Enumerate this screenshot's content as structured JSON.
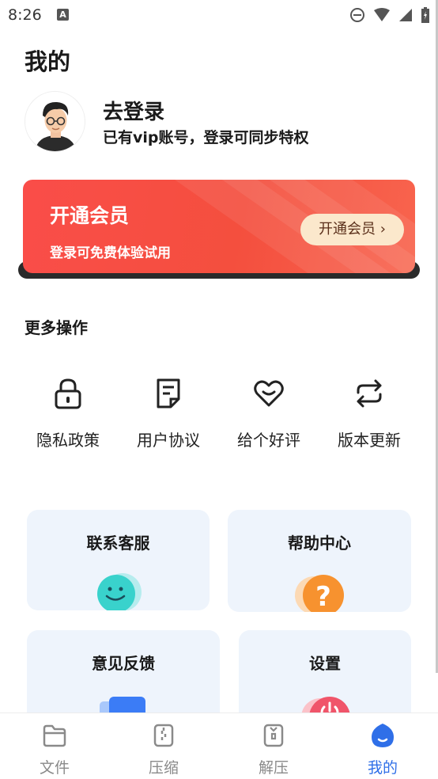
{
  "status_bar": {
    "time": "8:26",
    "badge": "A"
  },
  "page_title": "我的",
  "profile": {
    "login_title": "去登录",
    "login_sub": "已有vip账号，登录可同步特权"
  },
  "vip_banner": {
    "title": "开通会员",
    "subtitle": "登录可免费体验试用",
    "button_label": "开通会员 ›"
  },
  "more_actions": {
    "title": "更多操作",
    "items": [
      {
        "label": "隐私政策",
        "icon": "lock-icon"
      },
      {
        "label": "用户协议",
        "icon": "document-icon"
      },
      {
        "label": "给个好评",
        "icon": "heart-smile-icon"
      },
      {
        "label": "版本更新",
        "icon": "refresh-icon"
      }
    ]
  },
  "cards": [
    {
      "title": "联系客服",
      "icon": "smiley-bubble-icon"
    },
    {
      "title": "帮助中心",
      "icon": "question-icon"
    },
    {
      "title": "意见反馈",
      "icon": "feedback-icon"
    },
    {
      "title": "设置",
      "icon": "power-icon"
    }
  ],
  "bottom_nav": [
    {
      "label": "文件",
      "icon": "folder-icon",
      "active": false
    },
    {
      "label": "压缩",
      "icon": "zip-icon",
      "active": false
    },
    {
      "label": "解压",
      "icon": "unzip-icon",
      "active": false
    },
    {
      "label": "我的",
      "icon": "profile-drop-icon",
      "active": true
    }
  ],
  "colors": {
    "accent": "#2f6fe8",
    "vip_red": "#f44f3e",
    "vip_button": "#fbe8cc",
    "card_bg": "#eef4fc"
  }
}
